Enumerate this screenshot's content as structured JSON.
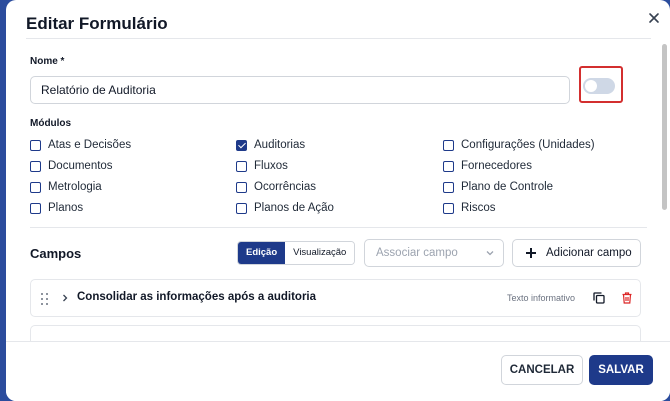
{
  "modal": {
    "title": "Editar Formulário",
    "close_icon": "close-icon"
  },
  "name_field": {
    "label": "Nome *",
    "value": "Relatório de Auditoria"
  },
  "toggle": {
    "state": "off",
    "highlight_color": "#d32f2f"
  },
  "modules": {
    "label": "Módulos",
    "columns": [
      [
        {
          "label": "Atas e Decisões",
          "checked": false
        },
        {
          "label": "Documentos",
          "checked": false
        },
        {
          "label": "Metrologia",
          "checked": false
        },
        {
          "label": "Planos",
          "checked": false
        }
      ],
      [
        {
          "label": "Auditorias",
          "checked": true
        },
        {
          "label": "Fluxos",
          "checked": false
        },
        {
          "label": "Ocorrências",
          "checked": false
        },
        {
          "label": "Planos de Ação",
          "checked": false
        }
      ],
      [
        {
          "label": "Configurações (Unidades)",
          "checked": false
        },
        {
          "label": "Fornecedores",
          "checked": false
        },
        {
          "label": "Plano de Controle",
          "checked": false
        },
        {
          "label": "Riscos",
          "checked": false
        }
      ]
    ]
  },
  "fields": {
    "title": "Campos",
    "view_toggle": {
      "edit_label": "Edição",
      "view_label": "Visualização",
      "selected": "Edição"
    },
    "associate_placeholder": "Associar campo",
    "add_button": "Adicionar campo",
    "rows": [
      {
        "label": "Consolidar as informações após a auditoria",
        "type": "Texto informativo"
      }
    ]
  },
  "footer": {
    "cancel": "CANCELAR",
    "save": "SALVAR"
  },
  "colors": {
    "primary": "#1e3a8a",
    "delete": "#dc2626",
    "backdrop": "#2b4c9d"
  }
}
